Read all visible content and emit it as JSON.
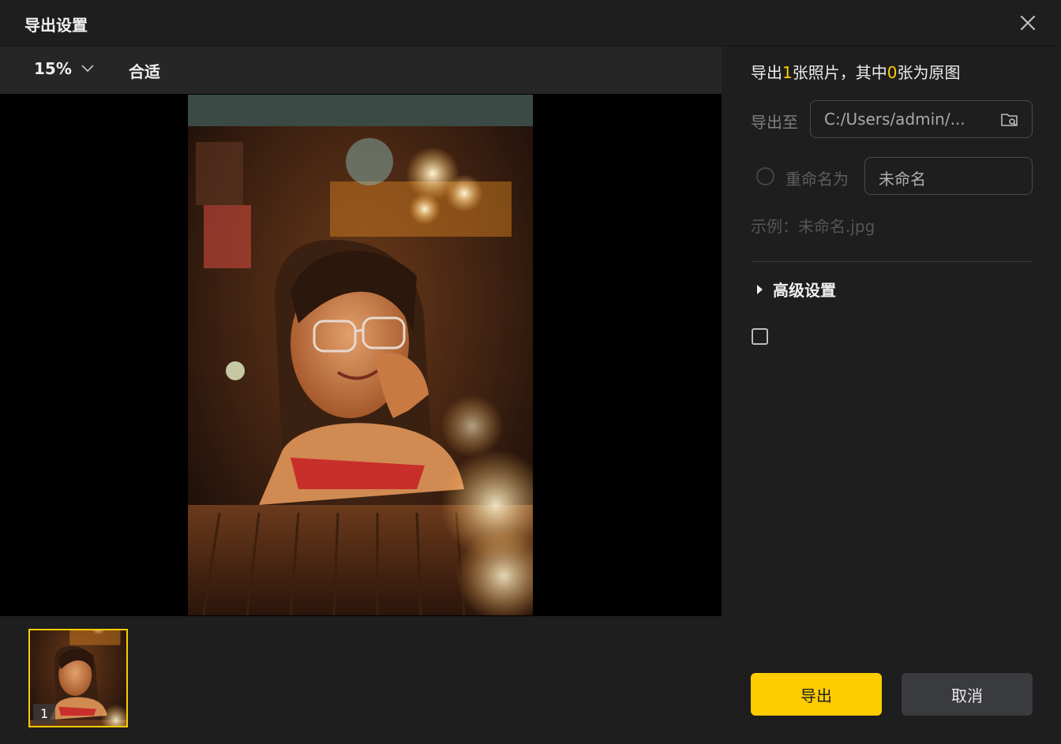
{
  "dialog": {
    "title": "导出设置"
  },
  "toolbar": {
    "zoom": "15%",
    "fit_label": "合适"
  },
  "thumbnails": [
    {
      "index": "1"
    }
  ],
  "summary": {
    "prefix": "导出",
    "photo_count": "1",
    "middle": "张照片，其中",
    "original_count": "0",
    "suffix": "张为原图"
  },
  "export_to": {
    "label": "导出至",
    "path": "C:/Users/admin/..."
  },
  "rename": {
    "label": "重命名为",
    "value": "未命名",
    "selected": false
  },
  "example": {
    "text": "示例：未命名.jpg"
  },
  "advanced": {
    "label": "高级设置"
  },
  "checkbox": {
    "checked": false
  },
  "buttons": {
    "export": "导出",
    "cancel": "取消"
  },
  "colors": {
    "accent": "#ffcc00",
    "panel": "#1e1e1e",
    "toolbar": "#262626",
    "cancel_bg": "#3a3b3e"
  },
  "icons": [
    "close-icon",
    "chevron-down-icon",
    "folder-search-icon",
    "caret-right-icon"
  ]
}
